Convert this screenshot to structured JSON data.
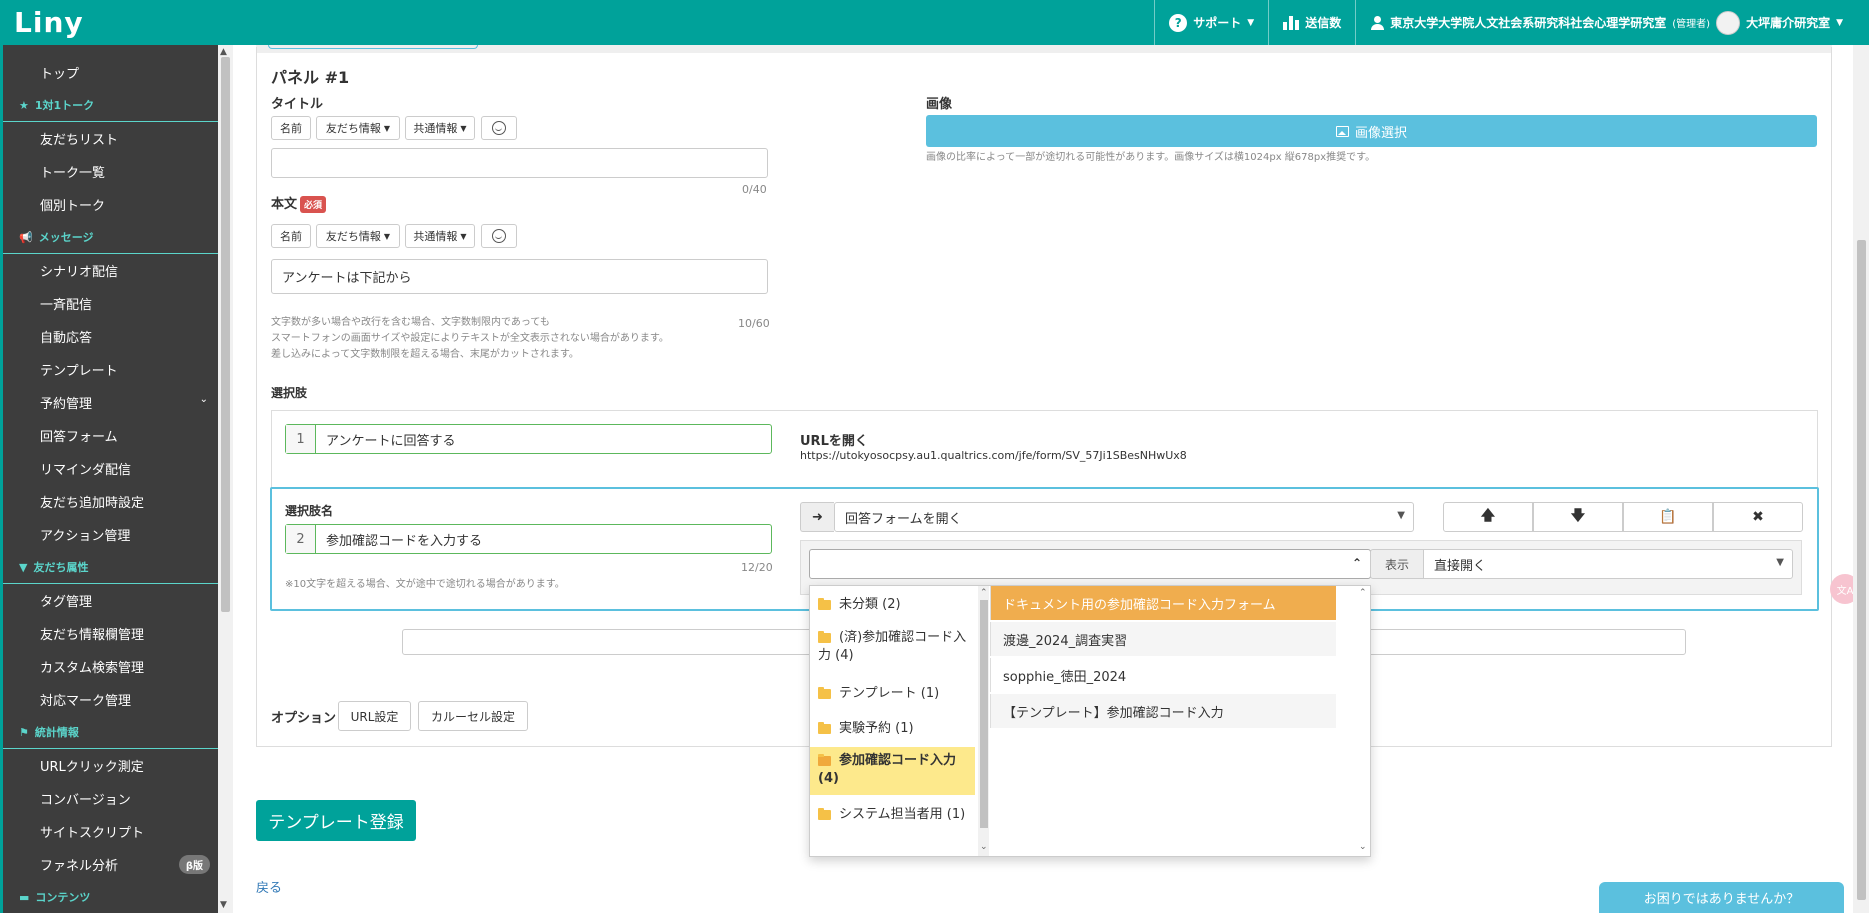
{
  "app": {
    "logo": "Liny"
  },
  "topnav": {
    "support": "サポート",
    "send_count": "送信数",
    "account": "東京大学大学院人文社会系研究科社会心理学研究室",
    "account_role": "(管理者)",
    "lab": "大坪庸介研究室"
  },
  "sidebar": {
    "items": [
      {
        "type": "nav",
        "label": "トップ"
      },
      {
        "type": "section",
        "label": "1対1トーク",
        "icon": "star-icon"
      },
      {
        "type": "nav",
        "label": "友だちリスト"
      },
      {
        "type": "nav",
        "label": "トーク一覧"
      },
      {
        "type": "nav",
        "label": "個別トーク"
      },
      {
        "type": "section",
        "label": "メッセージ",
        "icon": "megaphone-icon"
      },
      {
        "type": "nav",
        "label": "シナリオ配信"
      },
      {
        "type": "nav",
        "label": "一斉配信"
      },
      {
        "type": "nav",
        "label": "自動応答"
      },
      {
        "type": "nav",
        "label": "テンプレート"
      },
      {
        "type": "nav",
        "label": "予約管理"
      },
      {
        "type": "nav",
        "label": "回答フォーム"
      },
      {
        "type": "nav",
        "label": "リマインダ配信"
      },
      {
        "type": "nav",
        "label": "友だち追加時設定"
      },
      {
        "type": "nav",
        "label": "アクション管理"
      },
      {
        "type": "section",
        "label": "友だち属性",
        "icon": "filter-icon"
      },
      {
        "type": "nav",
        "label": "タグ管理"
      },
      {
        "type": "nav",
        "label": "友だち情報欄管理"
      },
      {
        "type": "nav",
        "label": "カスタム検索管理"
      },
      {
        "type": "nav",
        "label": "対応マーク管理"
      },
      {
        "type": "section",
        "label": "統計情報",
        "icon": "flag-icon"
      },
      {
        "type": "nav",
        "label": "URLクリック測定"
      },
      {
        "type": "nav",
        "label": "コンバージョン"
      },
      {
        "type": "nav",
        "label": "サイトスクリプト"
      },
      {
        "type": "nav",
        "label": "ファネル分析"
      },
      {
        "type": "section",
        "label": "コンテンツ",
        "icon": "folder-icon"
      }
    ],
    "beta_badge": "β版"
  },
  "panel": {
    "heading": "パネル #1",
    "title_label": "タイトル",
    "title_counter": "0/40",
    "body_label": "本文",
    "required_badge": "必須",
    "body_value": "アンケートは下記から",
    "body_counter": "10/60",
    "help_lines": [
      "文字数が多い場合や改行を含む場合、文字数制限内であっても",
      "スマートフォンの画面サイズや設定によりテキストが全文表示されない場合があります。",
      "差し込みによって文字数制限を超える場合、末尾がカットされます。"
    ],
    "insert_buttons": {
      "name": "名前",
      "friend_info": "友だち情報",
      "common_info": "共通情報"
    },
    "image_label": "画像",
    "image_button": "画像選択",
    "image_note": "画像の比率によって一部が途切れる可能性があります。画像サイズは横1024px 縦678px推奨です。"
  },
  "choices": {
    "label": "選択肢",
    "choice1": {
      "num": "1",
      "text": "アンケートに回答する",
      "action_label": "URLを開く",
      "url": "https://utokyosocpsy.au1.qualtrics.com/jfe/form/SV_57Ji1SBesNHwUx8"
    },
    "choice2": {
      "name_label": "選択肢名",
      "num": "2",
      "text": "参加確認コードを入力する",
      "counter": "12/20",
      "note": "※10文字を超える場合、文が途中で途切れる場合があります。",
      "action_select": "回答フォームを開く",
      "display_label": "表示",
      "display_select": "直接開く"
    }
  },
  "dropdown": {
    "folders": [
      {
        "label": "未分類 (2)"
      },
      {
        "label": "(済)参加確認コード入力 (4)"
      },
      {
        "label": "テンプレート (1)"
      },
      {
        "label": "実験予約 (1)"
      },
      {
        "label": "参加確認コード入力 (4)"
      },
      {
        "label": "システム担当者用 (1)"
      }
    ],
    "forms": [
      {
        "label": "ドキュメント用の参加確認コード入力フォーム"
      },
      {
        "label": "渡邊_2024_調査実習"
      },
      {
        "label": "sopphie_徳田_2024"
      },
      {
        "label": "【テンプレート】参加確認コード入力"
      }
    ]
  },
  "options": {
    "label": "オプション",
    "url_settings": "URL設定",
    "carousel_settings": "カルーセル設定"
  },
  "footer": {
    "register_button": "テンプレート登録",
    "back_link": "戻る",
    "help_chip": "お困りではありませんか？"
  },
  "colors": {
    "brand": "#00a29a",
    "info": "#5bc0de",
    "highlight": "#f0ad4e",
    "folder_active": "#fde98c"
  }
}
